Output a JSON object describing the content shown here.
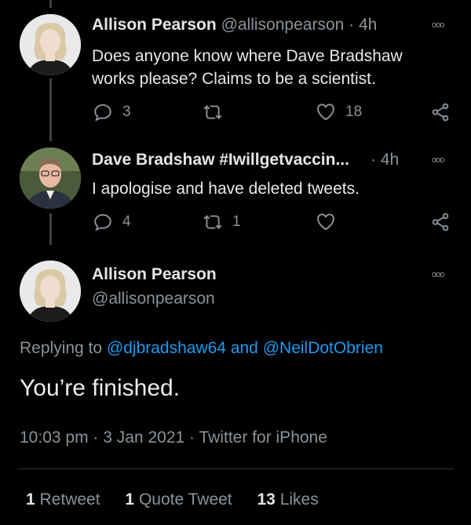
{
  "tweets": [
    {
      "name": "Allison Pearson",
      "handle": "@allisonpearson",
      "dot": "·",
      "time": "4h",
      "more": "ooo",
      "text_line1": "Does anyone know where Dave Bradshaw",
      "text_line2": "works please? Claims to be a scientist.",
      "replies": "3",
      "retweets": "",
      "likes": "18"
    },
    {
      "name": "Dave Bradshaw #Iwillgetvaccin...",
      "handle": "",
      "dot": "·",
      "time": "4h",
      "more": "ooo",
      "text_line1": "I apologise and have deleted tweets.",
      "replies": "4",
      "retweets": "1",
      "likes": ""
    }
  ],
  "main_tweet": {
    "name": "Allison Pearson",
    "handle": "@allisonpearson",
    "more": "ooo",
    "replying_prefix": "Replying to",
    "reply_user1": "@djbradshaw64",
    "reply_and": "and",
    "reply_user2": "@NeilDotObrien",
    "text": "You’re finished.",
    "time": "10:03 pm",
    "sep1": "·",
    "date": "3 Jan 2021",
    "sep2": "·",
    "source": "Twitter for iPhone"
  },
  "stats": {
    "retweet_count": "1",
    "retweet_label": "Retweet",
    "quote_count": "1",
    "quote_label": "Quote Tweet",
    "likes_count": "13",
    "likes_label": "Likes"
  },
  "icons": [
    "reply-icon",
    "retweet-icon",
    "like-icon",
    "share-icon"
  ],
  "colors": {
    "background": "#000000",
    "link": "#1d9bf0",
    "muted": "#8b9298"
  }
}
